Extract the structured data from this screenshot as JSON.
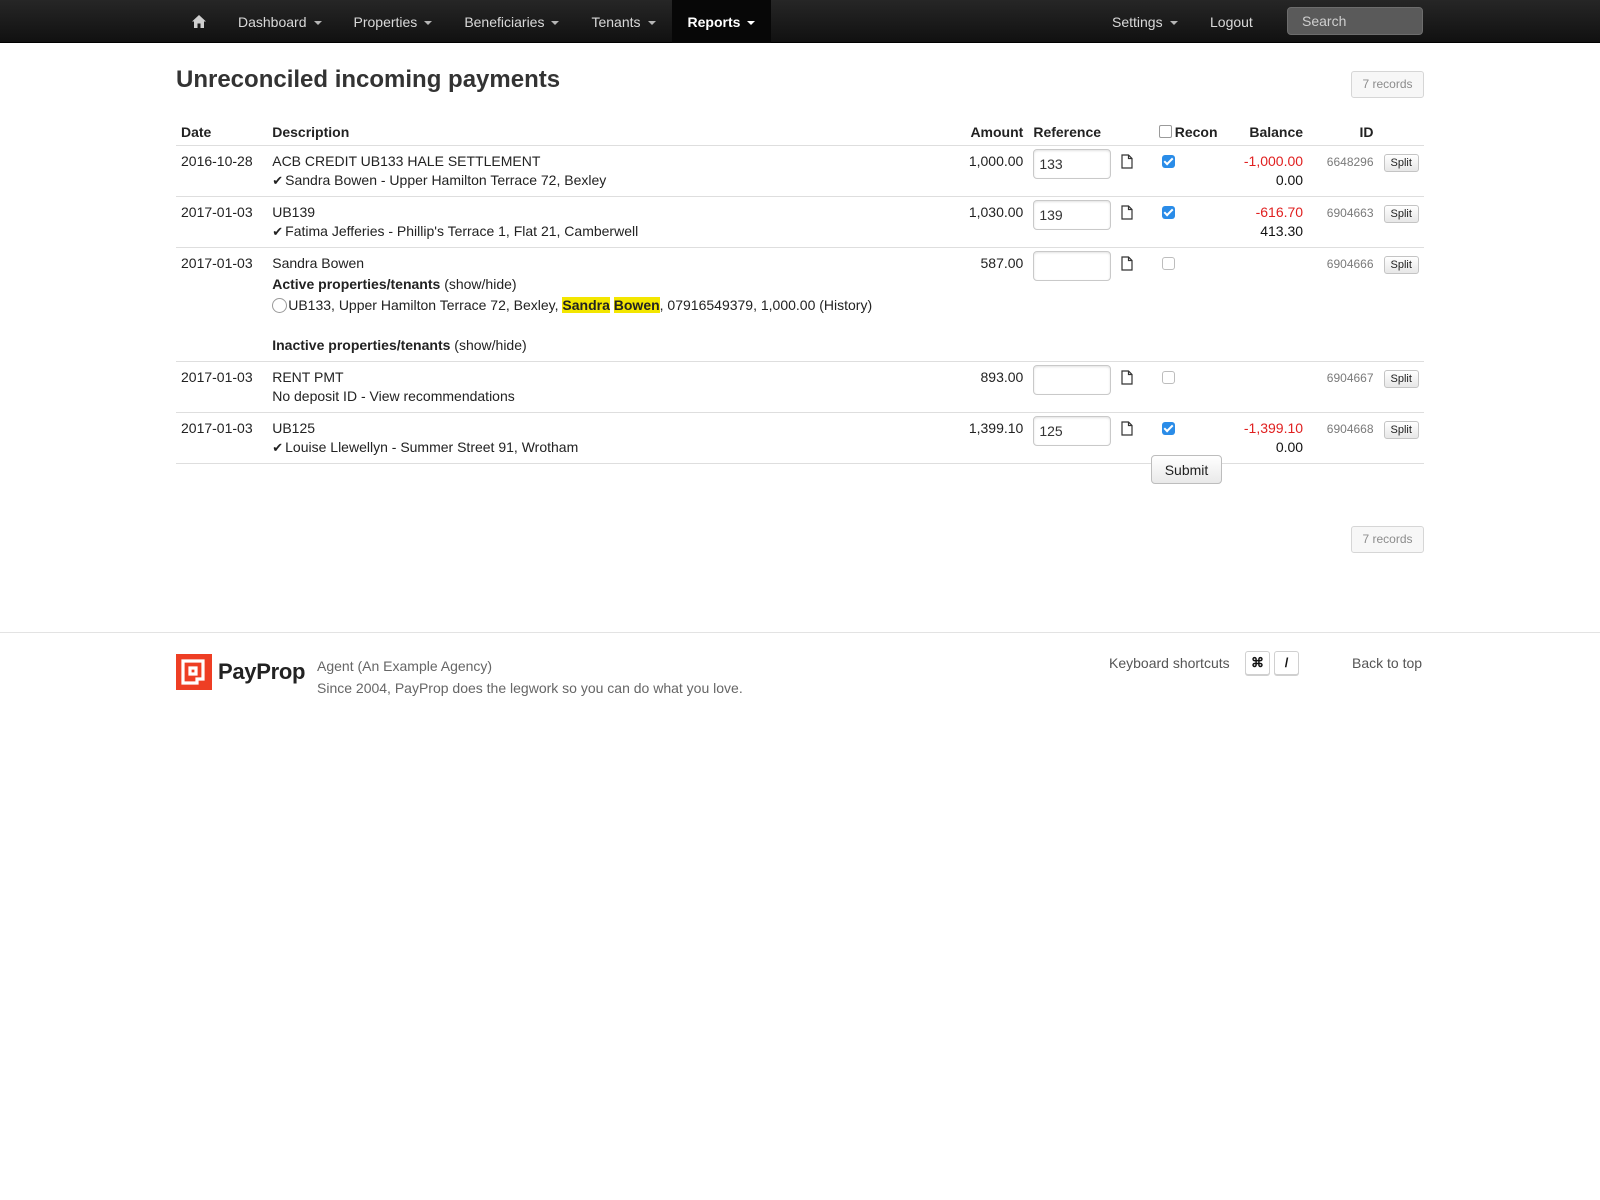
{
  "nav": {
    "home_icon": "home-icon",
    "items": [
      {
        "label": "Dashboard",
        "active": false
      },
      {
        "label": "Properties",
        "active": false
      },
      {
        "label": "Beneficiaries",
        "active": false
      },
      {
        "label": "Tenants",
        "active": false
      },
      {
        "label": "Reports",
        "active": true
      }
    ],
    "settings": "Settings",
    "logout": "Logout",
    "search_placeholder": "Search"
  },
  "page": {
    "title": "Unreconciled incoming payments",
    "records": "7 records"
  },
  "table": {
    "headers": {
      "date": "Date",
      "description": "Description",
      "amount": "Amount",
      "reference": "Reference",
      "recon": "Recon",
      "balance": "Balance",
      "id": "ID"
    },
    "rows": [
      {
        "date": "2016-10-28",
        "description": "ACB CREDIT UB133 HALE SETTLEMENT",
        "match": "Sandra Bowen - Upper Hamilton Terrace 72, Bexley",
        "amount": "1,000.00",
        "reference": "133",
        "recon": true,
        "balance_neg": "-1,000.00",
        "balance": "0.00",
        "id": "6648296",
        "split": "Split"
      },
      {
        "date": "2017-01-03",
        "description": "UB139",
        "match": "Fatima Jefferies - Phillip's Terrace 1, Flat 21, Camberwell",
        "amount": "1,030.00",
        "reference": "139",
        "recon": true,
        "balance_neg": "-616.70",
        "balance": "413.30",
        "id": "6904663",
        "split": "Split"
      },
      {
        "date": "2017-01-03",
        "description": "Sandra Bowen",
        "active_label": "Active properties/tenants",
        "show_hide": "(show/hide)",
        "option_prefix": "UB133, Upper Hamilton Terrace 72, Bexley,",
        "highlight_first": "Sandra",
        "highlight_last": "Bowen",
        "option_suffix": ", 07916549379, 1,000.00 (History)",
        "inactive_label": "Inactive properties/tenants",
        "amount": "587.00",
        "reference": "",
        "recon": false,
        "id": "6904666",
        "split": "Split"
      },
      {
        "date": "2017-01-03",
        "description": "RENT PMT",
        "note": "No deposit ID - View recommendations",
        "amount": "893.00",
        "reference": "",
        "recon": false,
        "id": "6904667",
        "split": "Split"
      },
      {
        "date": "2017-01-03",
        "description": "UB125",
        "match": "Louise Llewellyn - Summer Street 91, Wrotham",
        "amount": "1,399.10",
        "reference": "125",
        "recon": true,
        "balance_neg": "-1,399.10",
        "balance": "0.00",
        "id": "6904668",
        "split": "Split"
      }
    ],
    "submit": "Submit"
  },
  "footer": {
    "brand": "PayProp",
    "agent": "Agent (An Example Agency)",
    "tagline": "Since 2004, PayProp does the legwork so you can do what you love.",
    "keyboard_label": "Keyboard shortcuts",
    "key1": "⌘",
    "key2": "/",
    "back_to_top": "Back to top"
  },
  "colors": {
    "navbar": "#1c1c1c",
    "negative": "#e02020",
    "checkbox": "#2a8ce8",
    "highlight": "#f3e600",
    "brand": "#ee3e24"
  }
}
